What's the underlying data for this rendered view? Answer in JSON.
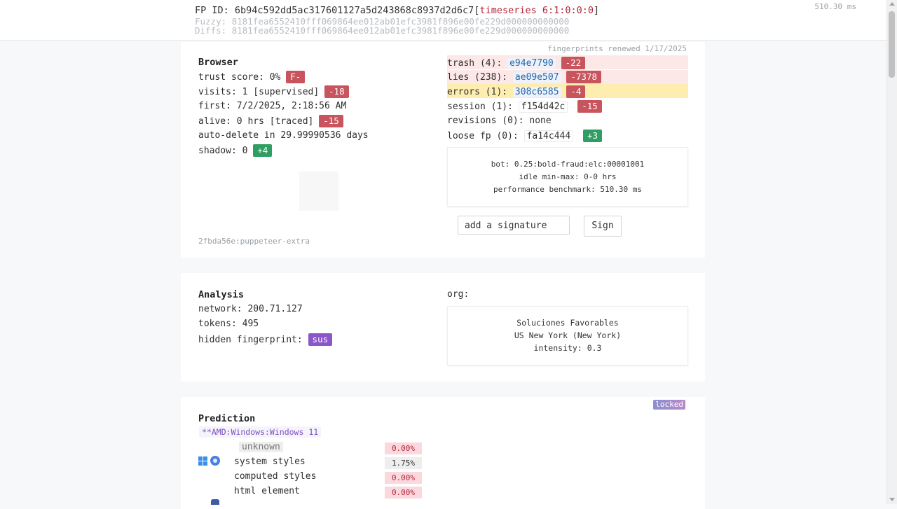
{
  "header": {
    "fp_id_label": "FP ID:",
    "fp_id_hash": "6b94c592dd5ac317601127a5d243868c8937d2d6c7",
    "fp_id_bracket_open": "[",
    "fp_id_timeseries": "timeseries 6:1:0:0:0",
    "fp_id_bracket_close": "]",
    "fuzzy_label": "Fuzzy:",
    "fuzzy_hash": "8181fea6552410fff069864ee012ab01efc3981f896e00fe229d000000000000",
    "diffs_label": "Diffs:",
    "diffs_hash": "8181fea6552410fff069864ee012ab01efc3981f896e00fe229d000000000000",
    "perf_time": "510.30 ms"
  },
  "browser": {
    "title": "Browser",
    "renewed": "fingerprints renewed 1/17/2025",
    "trust_score_label": "trust score: 0%",
    "trust_score_grade": "F-",
    "visits_label": "visits: 1 [supervised]",
    "visits_badge": "-18",
    "first_label": "first: 7/2/2025, 2:18:56 AM",
    "alive_label": "alive: 0 hrs [traced]",
    "alive_badge": "-15",
    "auto_delete": "auto-delete in 29.99990536 days",
    "shadow_label": "shadow: 0",
    "shadow_badge": "+4",
    "ua_note": "2fbda56e:puppeteer-extra",
    "trash_label": "trash (4):",
    "trash_hash": "e94e7790",
    "trash_badge": "-22",
    "lies_label": "lies (238):",
    "lies_hash": "ae09e507",
    "lies_badge": "-7378",
    "errors_label": "errors (1):",
    "errors_hash": "308c6585",
    "errors_badge": "-4",
    "session_label": "session (1):",
    "session_hash": "f154d42c",
    "session_badge": "-15",
    "revisions_label": "revisions (0): none",
    "loose_label": "loose fp (0):",
    "loose_hash": "fa14c444",
    "loose_badge": "+3",
    "bot_line": "bot: 0.25:bold-fraud:elc:00001001",
    "idle_line": "idle min-max: 0-0 hrs",
    "benchmark_line": "performance benchmark: 510.30 ms",
    "signature_placeholder": "add a signature",
    "sign_button": "Sign"
  },
  "analysis": {
    "title": "Analysis",
    "network": "network: 200.71.127",
    "tokens": "tokens: 495",
    "hidden_label": "hidden fingerprint:",
    "hidden_badge": "sus",
    "org_label": "org:",
    "org_name": "Soluciones Favorables",
    "org_location": "US New York (New York)",
    "org_intensity": "intensity: 0.3"
  },
  "prediction": {
    "title": "Prediction",
    "locked": "locked",
    "os_guess": "**AMD:Windows:Windows 11",
    "rows": [
      {
        "label": "unknown",
        "pct": "0.00%"
      },
      {
        "label": "system styles",
        "pct": "1.75%"
      },
      {
        "label": "computed styles",
        "pct": "0.00%"
      },
      {
        "label": "html element",
        "pct": "0.00%"
      }
    ]
  },
  "colors": {
    "badge_red": "#c8555d",
    "badge_green": "#2e9e62",
    "badge_purple": "#8b56c9",
    "highlight_pink": "#fde8e8",
    "highlight_yellow": "#fdeeb0"
  }
}
